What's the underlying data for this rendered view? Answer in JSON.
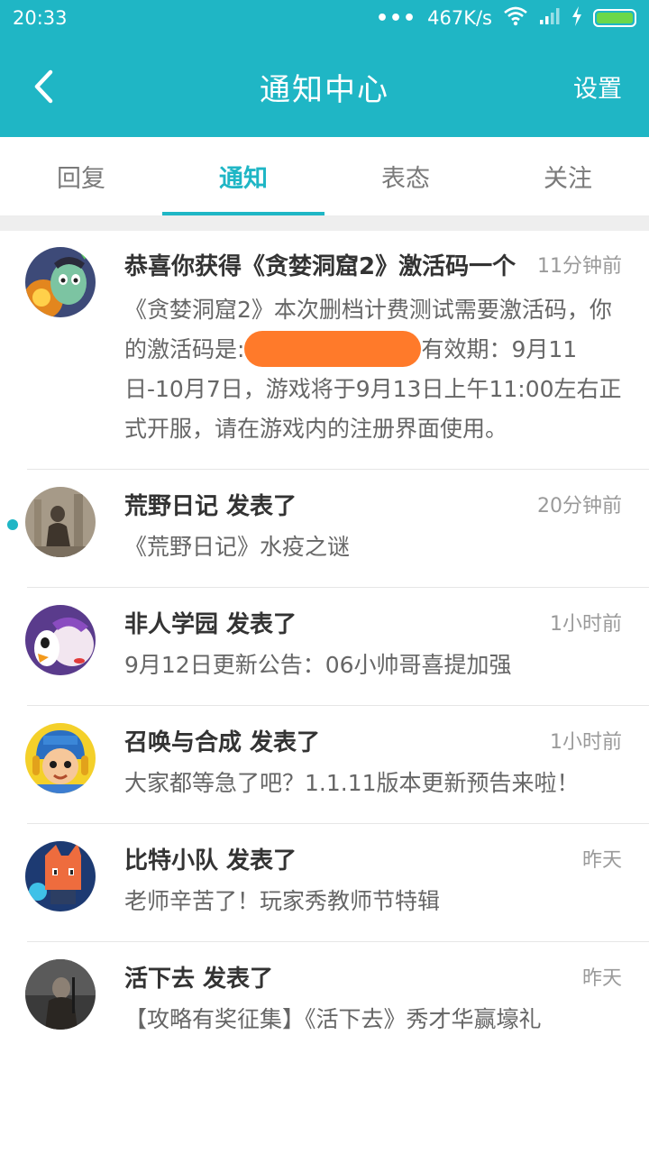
{
  "status_bar": {
    "time": "20:33",
    "dots": "•••",
    "speed": "467K/s",
    "icons": [
      "wifi-icon",
      "signal-icon",
      "charging-icon",
      "battery-icon"
    ],
    "battery_level": 1.0
  },
  "header": {
    "back_icon": "chevron-left-icon",
    "title": "通知中心",
    "settings_label": "设置"
  },
  "tabs": [
    {
      "label": "回复",
      "active": false
    },
    {
      "label": "通知",
      "active": true
    },
    {
      "label": "表态",
      "active": false
    },
    {
      "label": "关注",
      "active": false
    }
  ],
  "notifications": [
    {
      "title": "恭喜你获得《贪婪洞窟2》激活码一个",
      "time": "11分钟前",
      "body_pre": "《贪婪洞窟2》本次删档计费测试需要激活码，你的激活码是:",
      "body_post": "有效期：9月11日-10月7日，游戏将于9月13日上午11:00左右正式开服，请在游戏内的注册界面使用。",
      "unread": false
    },
    {
      "title": "荒野日记 发表了",
      "time": "20分钟前",
      "body": "《荒野日记》水疫之谜",
      "unread": true
    },
    {
      "title": "非人学园 发表了",
      "time": "1小时前",
      "body": "9月12日更新公告：06小帅哥喜提加强",
      "unread": false
    },
    {
      "title": "召唤与合成 发表了",
      "time": "1小时前",
      "body": "大家都等急了吧？1.1.11版本更新预告来啦！",
      "unread": false
    },
    {
      "title": "比特小队 发表了",
      "time": "昨天",
      "body": "老师辛苦了！玩家秀教师节特辑",
      "unread": false
    },
    {
      "title": "活下去 发表了",
      "time": "昨天",
      "body": "【攻略有奖征集】《活下去》秀才华赢壕礼",
      "unread": false
    }
  ],
  "colors": {
    "accent": "#1fb6c5",
    "redaction": "#ff7a2a"
  }
}
